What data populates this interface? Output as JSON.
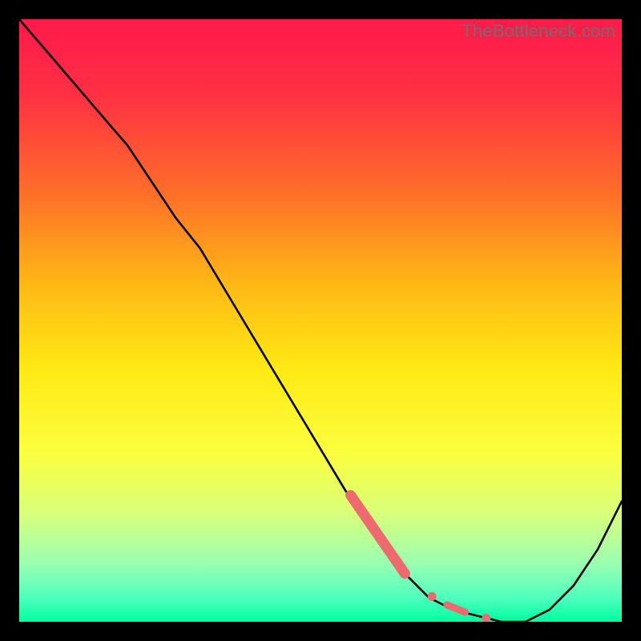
{
  "watermark": "TheBottleneck.com",
  "chart_data": {
    "type": "line",
    "title": "",
    "xlabel": "",
    "ylabel": "",
    "xlim": [
      0,
      100
    ],
    "ylim": [
      0,
      100
    ],
    "gradient_stops": [
      {
        "t": 0.0,
        "color": "#ff1a4b"
      },
      {
        "t": 0.12,
        "color": "#ff2e44"
      },
      {
        "t": 0.28,
        "color": "#ff6a2a"
      },
      {
        "t": 0.44,
        "color": "#ffb815"
      },
      {
        "t": 0.58,
        "color": "#ffe914"
      },
      {
        "t": 0.72,
        "color": "#fbff3e"
      },
      {
        "t": 0.82,
        "color": "#d8ff7a"
      },
      {
        "t": 0.9,
        "color": "#9dffb0"
      },
      {
        "t": 0.96,
        "color": "#4fffbf"
      },
      {
        "t": 1.0,
        "color": "#00ffa0"
      }
    ],
    "curve": {
      "x": [
        0,
        6,
        12,
        18,
        22,
        26,
        30,
        36,
        42,
        48,
        54,
        60,
        64,
        68,
        72,
        76,
        80,
        84,
        88,
        92,
        96,
        100
      ],
      "y": [
        100,
        93,
        86,
        79,
        73,
        67,
        62,
        52,
        42,
        32,
        22,
        13,
        8,
        4,
        2,
        1,
        0,
        0,
        2,
        6,
        12,
        20
      ]
    },
    "highlight_segments": [
      {
        "type": "thick",
        "x0": 55,
        "y0": 21,
        "x1": 64,
        "y1": 8
      },
      {
        "type": "dot",
        "x": 68.5,
        "y": 4.2
      },
      {
        "type": "short",
        "x0": 71,
        "y0": 2.8,
        "x1": 74,
        "y1": 1.6
      },
      {
        "type": "dot",
        "x": 77.5,
        "y": 0.6
      }
    ],
    "highlight_color": "#ed6a6f"
  }
}
